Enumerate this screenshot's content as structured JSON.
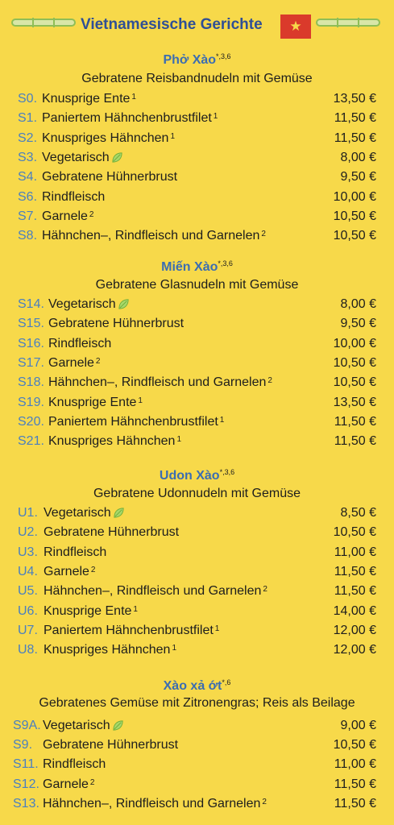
{
  "header": {
    "title": "Vietnamesische Gerichte",
    "flag_icon": "vietnam-flag-icon",
    "flag_star": "★"
  },
  "sections": [
    {
      "title": "Phở Xào",
      "allergens": "*,3,6",
      "subtitle": "Gebratene Reisbandnudeln mit Gemüse",
      "items": [
        {
          "code": "S0.",
          "name": "Knusprige Ente",
          "note": "1",
          "price": "13,50 €"
        },
        {
          "code": "S1.",
          "name": "Paniertem Hähnchenbrustfilet",
          "note": "1",
          "price": "11,50 €"
        },
        {
          "code": "S2.",
          "name": "Knuspriges Hähnchen",
          "note": "1",
          "price": "11,50 €"
        },
        {
          "code": "S3.",
          "name": "Vegetarisch",
          "note": "",
          "leaf": true,
          "price": "8,00 €"
        },
        {
          "code": "S4.",
          "name": "Gebratene Hühnerbrust",
          "note": "",
          "price": "9,50 €"
        },
        {
          "code": "S6.",
          "name": "Rindfleisch",
          "note": "",
          "price": "10,00 €"
        },
        {
          "code": "S7.",
          "name": "Garnele",
          "note": "2",
          "price": "10,50 €"
        },
        {
          "code": "S8.",
          "name": "Hähnchen–, Rindfleisch und Garnelen",
          "note": "2",
          "price": "10,50 €"
        }
      ]
    },
    {
      "title": "Miến Xào",
      "allergens": "*,3,6",
      "subtitle": "Gebratene Glasnudeln mit Gemüse",
      "items": [
        {
          "code": "S14.",
          "name": "Vegetarisch",
          "note": "",
          "leaf": true,
          "price": "8,00 €"
        },
        {
          "code": "S15.",
          "name": "Gebratene Hühnerbrust",
          "note": "",
          "price": "9,50 €"
        },
        {
          "code": "S16.",
          "name": "Rindfleisch",
          "note": "",
          "price": "10,00 €"
        },
        {
          "code": "S17.",
          "name": "Garnele",
          "note": "2",
          "price": "10,50 €"
        },
        {
          "code": "S18.",
          "name": "Hähnchen–, Rindfleisch und Garnelen",
          "note": "2",
          "price": "10,50 €"
        },
        {
          "code": "S19.",
          "name": "Knusprige Ente",
          "note": "1",
          "price": "13,50 €"
        },
        {
          "code": "S20.",
          "name": "Paniertem Hähnchenbrustfilet",
          "note": "1",
          "price": "11,50 €"
        },
        {
          "code": "S21.",
          "name": "Knuspriges Hähnchen",
          "note": "1",
          "price": "11,50 €"
        }
      ]
    },
    {
      "title": "Udon Xào",
      "allergens": "*,3,6",
      "subtitle": "Gebratene Udonnudeln mit Gemüse",
      "items": [
        {
          "code": "U1.",
          "name": "Vegetarisch",
          "note": "",
          "leaf": true,
          "price": "8,50 €"
        },
        {
          "code": "U2.",
          "name": "Gebratene Hühnerbrust",
          "note": "",
          "price": "10,50 €"
        },
        {
          "code": "U3.",
          "name": "Rindfleisch",
          "note": "",
          "price": "11,00 €"
        },
        {
          "code": "U4.",
          "name": "Garnele",
          "note": "2",
          "price": "11,50 €"
        },
        {
          "code": "U5.",
          "name": "Hähnchen–, Rindfleisch und Garnelen",
          "note": "2",
          "price": "11,50 €"
        },
        {
          "code": "U6.",
          "name": "Knusprige Ente",
          "note": "1",
          "price": "14,00 €"
        },
        {
          "code": "U7.",
          "name": "Paniertem Hähnchenbrustfilet",
          "note": "1",
          "price": "12,00 €"
        },
        {
          "code": "U8.",
          "name": "Knuspriges Hähnchen",
          "note": "1",
          "price": "12,00 €"
        }
      ]
    },
    {
      "title": "Xào xả ớt",
      "allergens": "*,6",
      "subtitle": "Gebratenes Gemüse mit Zitronengras; Reis als Beilage",
      "items": [
        {
          "code": "S9A.",
          "name": "Vegetarisch",
          "note": "",
          "leaf": true,
          "price": "9,00 €"
        },
        {
          "code": "S9.",
          "name": "Gebratene Hühnerbrust",
          "note": "",
          "price": "10,50 €"
        },
        {
          "code": "S11.",
          "name": "Rindfleisch",
          "note": "",
          "price": "11,00 €"
        },
        {
          "code": "S12.",
          "name": "Garnele",
          "note": "2",
          "price": "11,50 €"
        },
        {
          "code": "S13.",
          "name": "Hähnchen–, Rindfleisch und Garnelen",
          "note": "2",
          "price": "11,50 €"
        }
      ]
    }
  ]
}
